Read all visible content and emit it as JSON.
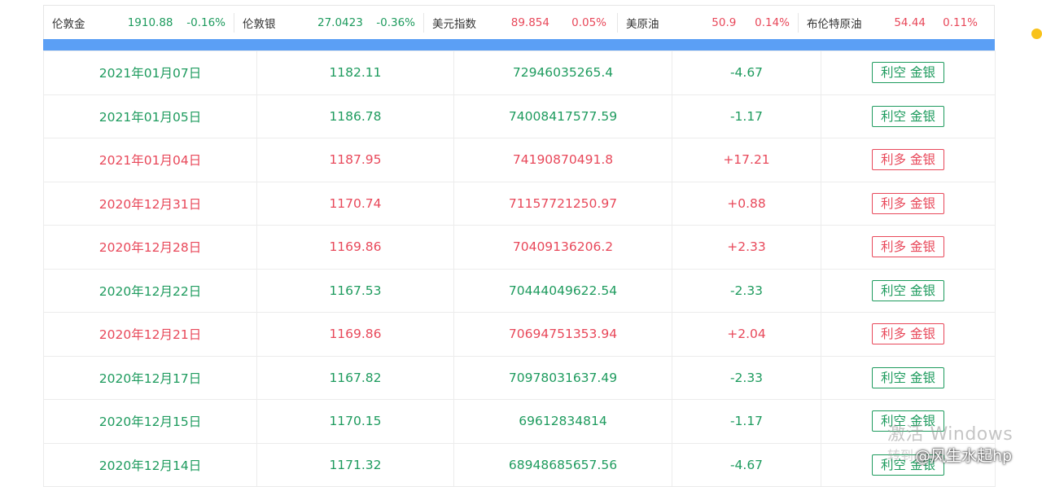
{
  "ticker": [
    {
      "name": "伦敦金",
      "price": "1910.88",
      "change": "-0.16%",
      "color": "#1e9b5e"
    },
    {
      "name": "伦敦银",
      "price": "27.0423",
      "change": "-0.36%",
      "color": "#1e9b5e"
    },
    {
      "name": "美元指数",
      "price": "89.854",
      "change": "0.05%",
      "color": "#e8485a"
    },
    {
      "name": "美原油",
      "price": "50.9",
      "change": "0.14%",
      "color": "#e8485a"
    },
    {
      "name": "布伦特原油",
      "price": "54.44",
      "change": "0.11%",
      "color": "#e8485a"
    }
  ],
  "rows": [
    {
      "date": "2021年01月07日",
      "price": "1182.11",
      "amount": "72946035265.4",
      "change": "-4.67",
      "tag": "利空 金银",
      "trend": "down"
    },
    {
      "date": "2021年01月05日",
      "price": "1186.78",
      "amount": "74008417577.59",
      "change": "-1.17",
      "tag": "利空 金银",
      "trend": "down"
    },
    {
      "date": "2021年01月04日",
      "price": "1187.95",
      "amount": "74190870491.8",
      "change": "+17.21",
      "tag": "利多 金银",
      "trend": "up"
    },
    {
      "date": "2020年12月31日",
      "price": "1170.74",
      "amount": "71157721250.97",
      "change": "+0.88",
      "tag": "利多 金银",
      "trend": "up"
    },
    {
      "date": "2020年12月28日",
      "price": "1169.86",
      "amount": "70409136206.2",
      "change": "+2.33",
      "tag": "利多 金银",
      "trend": "up"
    },
    {
      "date": "2020年12月22日",
      "price": "1167.53",
      "amount": "70444049622.54",
      "change": "-2.33",
      "tag": "利空 金银",
      "trend": "down"
    },
    {
      "date": "2020年12月21日",
      "price": "1169.86",
      "amount": "70694751353.94",
      "change": "+2.04",
      "tag": "利多 金银",
      "trend": "up"
    },
    {
      "date": "2020年12月17日",
      "price": "1167.82",
      "amount": "70978031637.49",
      "change": "-2.33",
      "tag": "利空 金银",
      "trend": "down"
    },
    {
      "date": "2020年12月15日",
      "price": "1170.15",
      "amount": "69612834814",
      "change": "-1.17",
      "tag": "利空 金银",
      "trend": "down"
    },
    {
      "date": "2020年12月14日",
      "price": "1171.32",
      "amount": "68948685657.56",
      "change": "-4.67",
      "tag": "利空 金银",
      "trend": "down"
    }
  ],
  "watermark": {
    "line1": "激活 Windows",
    "line2": "转到",
    "brand": "@风生水起hp"
  }
}
